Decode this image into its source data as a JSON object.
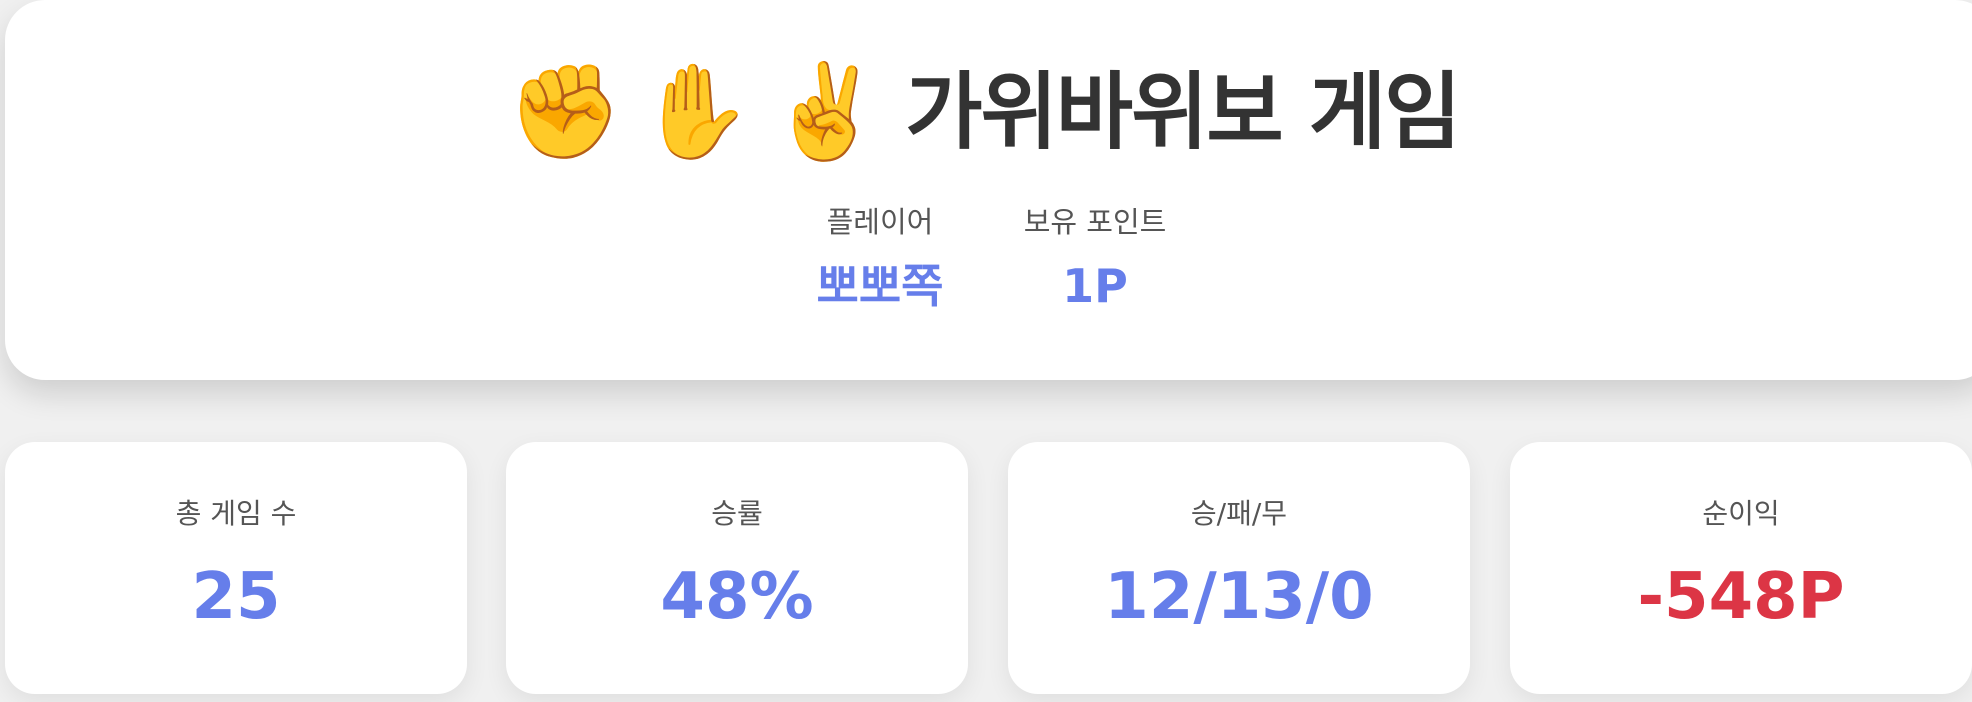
{
  "header": {
    "emojis": [
      "✊",
      "✋",
      "✌️"
    ],
    "title": "가위바위보 게임",
    "player_label": "플레이어",
    "player_name": "뽀뽀쪽",
    "points_label": "보유 포인트",
    "points_value": "1P"
  },
  "stats": [
    {
      "label": "총 게임 수",
      "value": "25"
    },
    {
      "label": "승률",
      "value": "48%"
    },
    {
      "label": "승/패/무",
      "value": "12/13/0"
    },
    {
      "label": "순이익",
      "value": "-548P"
    }
  ],
  "colors": {
    "accent": "#667eea",
    "negative": "#dc3545",
    "title": "#333333",
    "label": "#555555",
    "background": "#f0f0f0",
    "card": "#ffffff"
  }
}
